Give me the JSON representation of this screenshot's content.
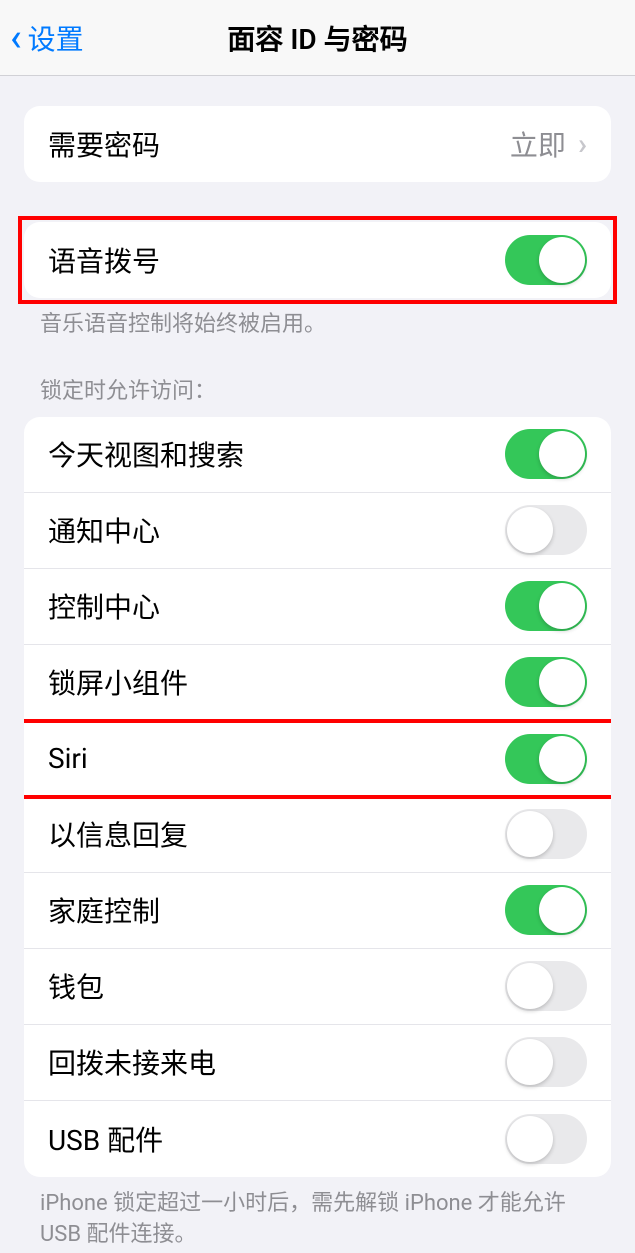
{
  "header": {
    "back_label": "设置",
    "title": "面容 ID 与密码"
  },
  "require_passcode": {
    "label": "需要密码",
    "value": "立即"
  },
  "voice_dial": {
    "label": "语音拨号",
    "footer": "音乐语音控制将始终被启用。"
  },
  "lock_section": {
    "header": "锁定时允许访问：",
    "items": [
      {
        "label": "今天视图和搜索",
        "on": true
      },
      {
        "label": "通知中心",
        "on": false
      },
      {
        "label": "控制中心",
        "on": true
      },
      {
        "label": "锁屏小组件",
        "on": true
      },
      {
        "label": "Siri",
        "on": true
      },
      {
        "label": "以信息回复",
        "on": false
      },
      {
        "label": "家庭控制",
        "on": true
      },
      {
        "label": "钱包",
        "on": false
      },
      {
        "label": "回拨未接来电",
        "on": false
      },
      {
        "label": "USB 配件",
        "on": false
      }
    ],
    "footer": "iPhone 锁定超过一小时后，需先解锁 iPhone 才能允许USB 配件连接。"
  }
}
